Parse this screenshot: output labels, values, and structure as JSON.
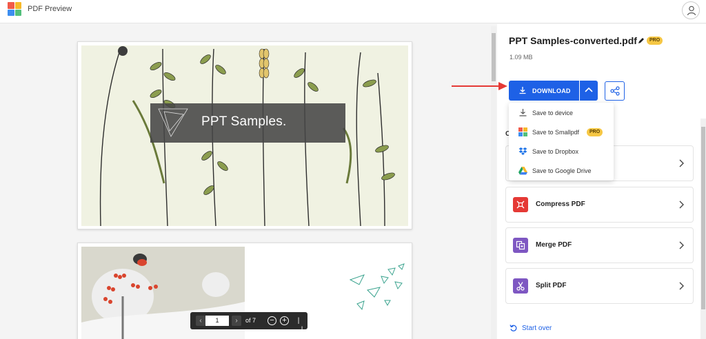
{
  "app": {
    "title": "PDF Preview"
  },
  "viewer": {
    "page1_text": "PPT Samples.",
    "pager": {
      "current_page": "1",
      "of_text": "of 7",
      "zoom_out": "−",
      "zoom_in": "+",
      "fit": "|↔|"
    }
  },
  "file": {
    "name": "PPT Samples-converted.pdf",
    "size": "1.09 MB",
    "pro_label": "PRO"
  },
  "download": {
    "label": "DOWNLOAD",
    "menu": [
      {
        "label": "Save to device",
        "icon": "download-icon"
      },
      {
        "label": "Save to Smallpdf",
        "icon": "smallpdf-icon",
        "badge": "PRO"
      },
      {
        "label": "Save to Dropbox",
        "icon": "dropbox-icon"
      },
      {
        "label": "Save to Google Drive",
        "icon": "google-drive-icon"
      }
    ]
  },
  "tools": {
    "partial_heading": "C",
    "items": [
      {
        "label": "",
        "color": "#ffffff"
      },
      {
        "label": "Compress PDF",
        "color": "#e53935"
      },
      {
        "label": "Merge PDF",
        "color": "#7e57c2"
      },
      {
        "label": "Split PDF",
        "color": "#7e57c2"
      }
    ]
  },
  "start_over": "Start over",
  "colors": {
    "accent": "#1e61e6",
    "pro": "#f6c744",
    "arrow": "#e53935"
  }
}
